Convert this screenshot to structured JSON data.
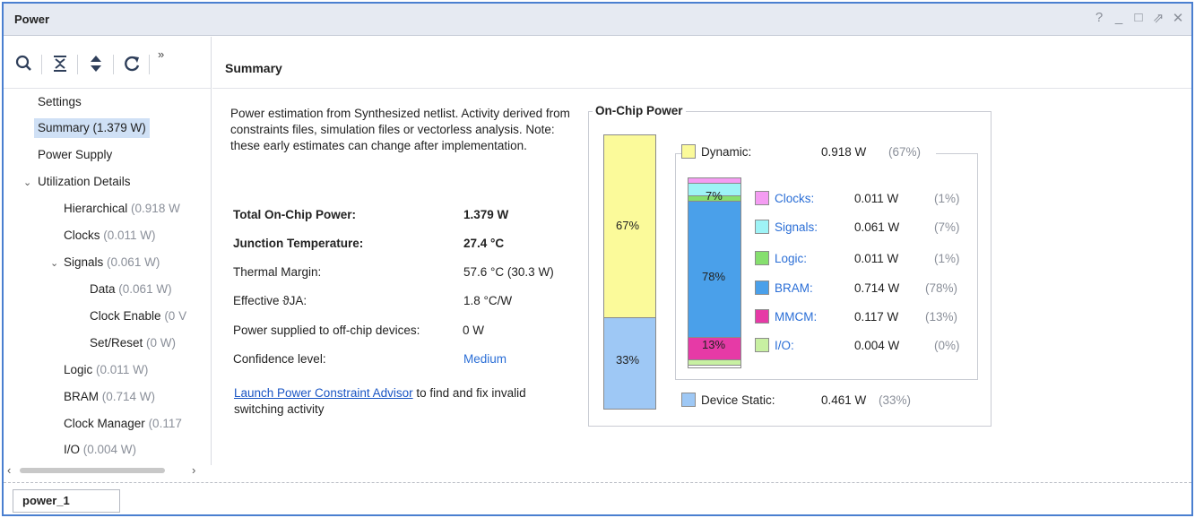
{
  "window": {
    "title": "Power",
    "controls": [
      "?",
      "_",
      "□",
      "⇗",
      "✕"
    ]
  },
  "toolbar": {
    "more": "»"
  },
  "sidebar": {
    "items": [
      {
        "label": "Settings",
        "value": ""
      },
      {
        "label": "Summary (1.379 W)",
        "value": ""
      },
      {
        "label": "Power Supply",
        "value": ""
      },
      {
        "label": "Utilization Details",
        "value": ""
      },
      {
        "label": "Hierarchical",
        "value": "(0.918 W"
      },
      {
        "label": "Clocks",
        "value": "(0.011 W)"
      },
      {
        "label": "Signals",
        "value": "(0.061 W)"
      },
      {
        "label": "Data",
        "value": "(0.061 W)"
      },
      {
        "label": "Clock Enable",
        "value": "(0 V"
      },
      {
        "label": "Set/Reset",
        "value": "(0 W)"
      },
      {
        "label": "Logic",
        "value": "(0.011 W)"
      },
      {
        "label": "BRAM",
        "value": "(0.714 W)"
      },
      {
        "label": "Clock Manager",
        "value": "(0.117"
      },
      {
        "label": "I/O",
        "value": "(0.004 W)"
      }
    ]
  },
  "main": {
    "header": "Summary",
    "description": "Power estimation from Synthesized netlist. Activity derived from constraints files, simulation files or vectorless analysis. Note: these early estimates can change after implementation.",
    "rows": [
      {
        "key": "Total On-Chip Power:",
        "value": "1.379 W"
      },
      {
        "key": "Junction Temperature:",
        "value": "27.4 °C"
      },
      {
        "key": "Thermal Margin:",
        "value": "57.6 °C (30.3 W)"
      },
      {
        "key": "Effective ϑJA:",
        "value": "1.8 °C/W"
      },
      {
        "key": "Power supplied to off-chip devices:",
        "value": "0 W"
      },
      {
        "key": "Confidence level:",
        "value": "Medium"
      }
    ],
    "launch_link": "Launch Power Constraint Advisor",
    "launch_rest": " to find and fix invalid switching activity"
  },
  "on_chip_power": {
    "title": "On-Chip Power",
    "outer_bar": {
      "dynamic_label": "67%",
      "static_label": "33%",
      "dynamic_fraction": 0.67,
      "static_fraction": 0.33
    },
    "dynamic": {
      "label": "Dynamic:",
      "value": "0.918 W",
      "pct": "(67%)",
      "color": "#fbfa9a"
    },
    "static": {
      "label": "Device Static:",
      "value": "0.461 W",
      "pct": "(33%)",
      "color": "#9ec8f5"
    },
    "inner_bar_labels": {
      "signals": "7%",
      "bram": "78%",
      "mmcm": "13%"
    },
    "breakdown": [
      {
        "name": "Clocks:",
        "value": "0.011 W",
        "pct": "(1%)",
        "color": "#f49cf2",
        "fraction": 0.01
      },
      {
        "name": "Signals:",
        "value": "0.061 W",
        "pct": "(7%)",
        "color": "#9ef3f6",
        "fraction": 0.07
      },
      {
        "name": "Logic:",
        "value": "0.011 W",
        "pct": "(1%)",
        "color": "#86df6e",
        "fraction": 0.01
      },
      {
        "name": "BRAM:",
        "value": "0.714 W",
        "pct": "(78%)",
        "color": "#4aa0ea",
        "fraction": 0.78
      },
      {
        "name": "MMCM:",
        "value": "0.117 W",
        "pct": "(13%)",
        "color": "#e63aa6",
        "fraction": 0.13
      },
      {
        "name": "I/O:",
        "value": "0.004 W",
        "pct": "(0%)",
        "color": "#c8f0a2",
        "fraction": 0.0
      }
    ]
  },
  "bottom": {
    "tab": "power_1"
  }
}
